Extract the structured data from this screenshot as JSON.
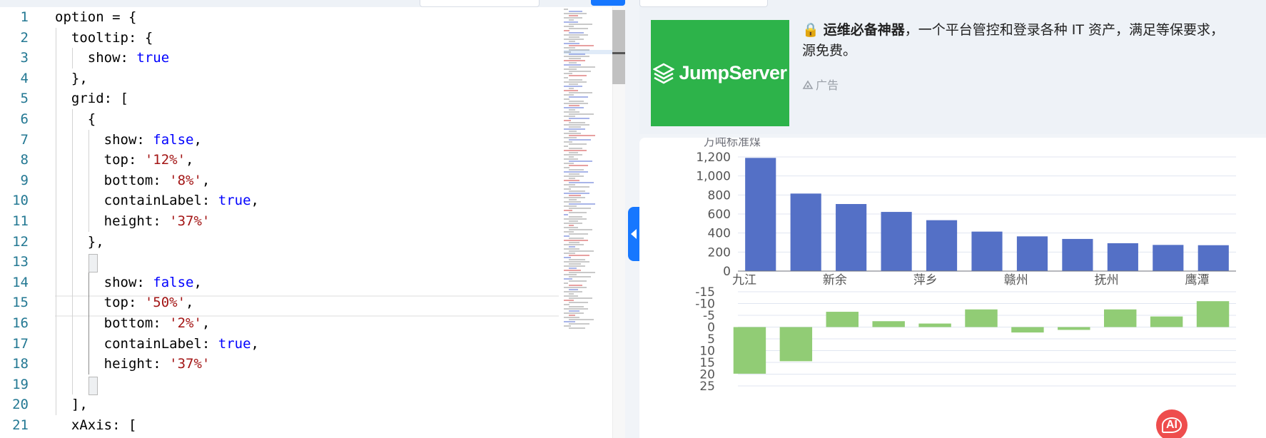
{
  "editor": {
    "line_numbers": [
      "1",
      "2",
      "3",
      "4",
      "5",
      "6",
      "7",
      "8",
      "9",
      "10",
      "11",
      "12",
      "13",
      "14",
      "15",
      "16",
      "17",
      "18",
      "19",
      "20",
      "21"
    ],
    "lines": [
      [
        {
          "t": "option = {",
          "c": "key"
        }
      ],
      [
        {
          "t": "  tooltip: {",
          "c": "key"
        }
      ],
      [
        {
          "t": "    show: ",
          "c": "key"
        },
        {
          "t": "true",
          "c": "bool"
        }
      ],
      [
        {
          "t": "  },",
          "c": "key"
        }
      ],
      [
        {
          "t": "  grid: [",
          "c": "key"
        }
      ],
      [
        {
          "t": "    {",
          "c": "key"
        }
      ],
      [
        {
          "t": "      show: ",
          "c": "key"
        },
        {
          "t": "false",
          "c": "bool"
        },
        {
          "t": ",",
          "c": "key"
        }
      ],
      [
        {
          "t": "      top: ",
          "c": "key"
        },
        {
          "t": "'12%'",
          "c": "str"
        },
        {
          "t": ",",
          "c": "key"
        }
      ],
      [
        {
          "t": "      bottom: ",
          "c": "key"
        },
        {
          "t": "'8%'",
          "c": "str"
        },
        {
          "t": ",",
          "c": "key"
        }
      ],
      [
        {
          "t": "      containLabel: ",
          "c": "key"
        },
        {
          "t": "true",
          "c": "bool"
        },
        {
          "t": ",",
          "c": "key"
        }
      ],
      [
        {
          "t": "      height: ",
          "c": "key"
        },
        {
          "t": "'37%'",
          "c": "str"
        }
      ],
      [
        {
          "t": "    },",
          "c": "key"
        }
      ],
      [
        {
          "t": "    {",
          "c": "key"
        }
      ],
      [
        {
          "t": "      show: ",
          "c": "key"
        },
        {
          "t": "false",
          "c": "bool"
        },
        {
          "t": ",",
          "c": "key"
        }
      ],
      [
        {
          "t": "      top: ",
          "c": "key"
        },
        {
          "t": "'50%'",
          "c": "str"
        },
        {
          "t": ",",
          "c": "key"
        }
      ],
      [
        {
          "t": "      bottom: ",
          "c": "key"
        },
        {
          "t": "'2%'",
          "c": "str"
        },
        {
          "t": ",",
          "c": "key"
        }
      ],
      [
        {
          "t": "      containLabel: ",
          "c": "key"
        },
        {
          "t": "true",
          "c": "bool"
        },
        {
          "t": ",",
          "c": "key"
        }
      ],
      [
        {
          "t": "      height: ",
          "c": "key"
        },
        {
          "t": "'37%'",
          "c": "str"
        }
      ],
      [
        {
          "t": "    }",
          "c": "key"
        }
      ],
      [
        {
          "t": "  ],",
          "c": "key"
        }
      ],
      [
        {
          "t": "  xAxis: [",
          "c": "key"
        }
      ]
    ]
  },
  "ad": {
    "logo_text": "JumpServer",
    "lock_glyph": "🔒",
    "headline_bold": "运维必备神器",
    "headline_rest": "，一个平台管控和登录各种 IT 资产，满足等保要求，",
    "headline_line2": "源免费。",
    "tag": "广告"
  },
  "fab": {
    "label": "AI"
  },
  "chart_data": [
    {
      "type": "bar",
      "ylabel": "万吨标准煤",
      "ylim": [
        0,
        1200
      ],
      "y_ticks": [
        "0",
        "200",
        "400",
        "600",
        "800",
        "1,000",
        "1,200"
      ],
      "x_tick_labels": [
        "九江",
        "新余",
        "萍乡",
        "赣州",
        "抚州",
        "鹰潭"
      ],
      "values": [
        1190,
        815,
        705,
        622,
        535,
        415,
        365,
        338,
        293,
        275,
        272
      ],
      "color": "#5470c6"
    },
    {
      "type": "bar",
      "ylim": [
        -15,
        25
      ],
      "y_inverse": true,
      "y_ticks": [
        "-15",
        "-10",
        "-5",
        "0",
        "5",
        "10",
        "15",
        "20",
        "25"
      ],
      "values": [
        19.8,
        14.5,
        -6.5,
        -2.5,
        -1.5,
        -7.5,
        2.3,
        1.2,
        -7.5,
        -4.5,
        -11
      ],
      "color": "#91cc75"
    }
  ]
}
